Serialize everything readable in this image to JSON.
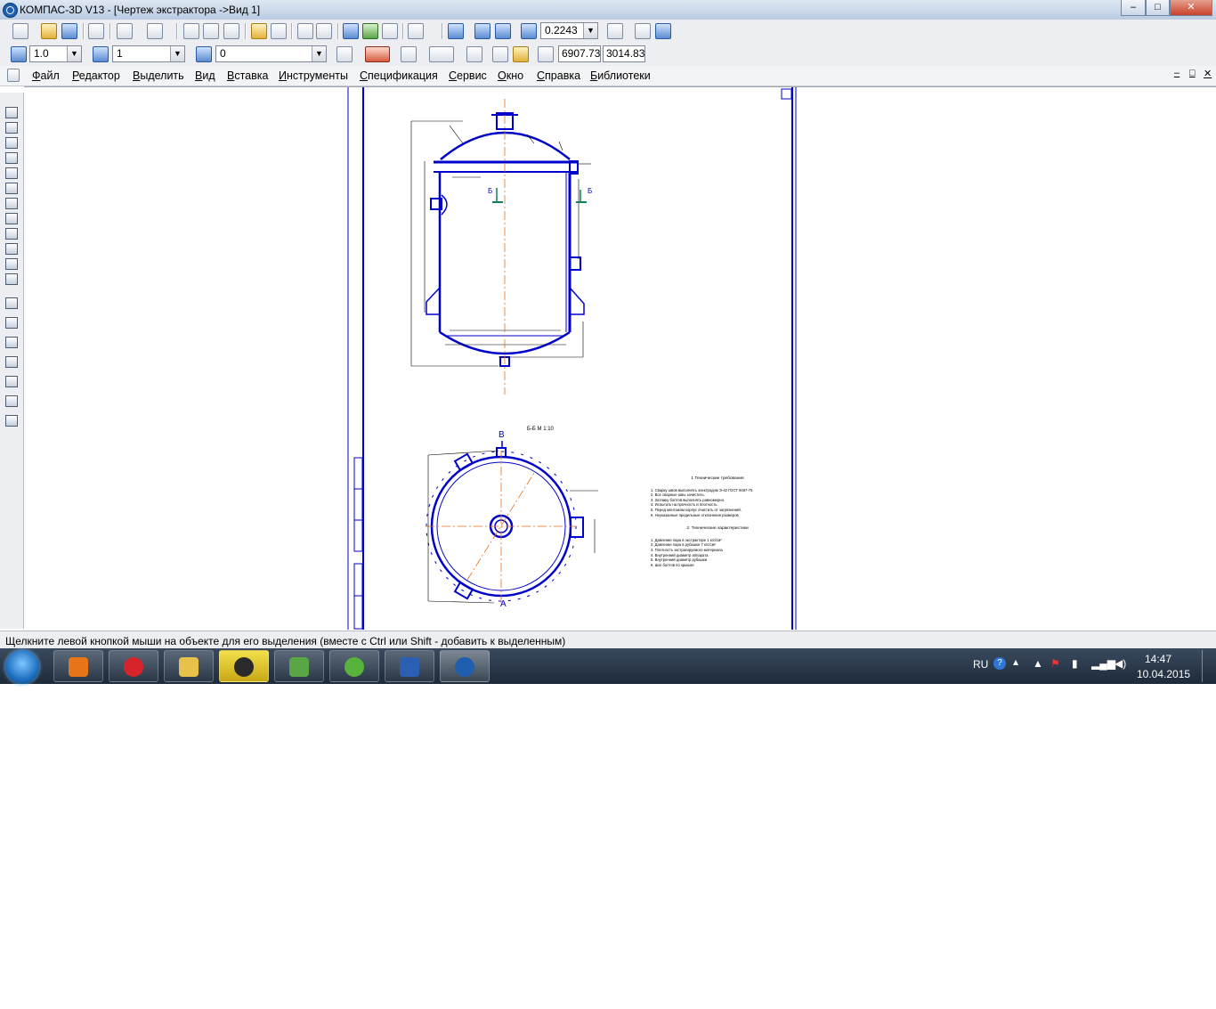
{
  "window": {
    "title": "КОМПАС-3D V13 - [Чертеж экстрактора ->Вид 1]",
    "buttons": {
      "minimize": "–",
      "maximize": "□",
      "close": "✕"
    }
  },
  "toolbar1": {
    "zoom_value": "0.2243"
  },
  "toolbar2": {
    "scale_value": "1.0",
    "layer_value": "1",
    "style_value": "0",
    "coord_x": "6907.73",
    "coord_y": "3014.83"
  },
  "menu": {
    "items": [
      "Файл",
      "Редактор",
      "Выделить",
      "Вид",
      "Вставка",
      "Инструменты",
      "Спецификация",
      "Сервис",
      "Окно",
      "Справка",
      "Библиотеки"
    ]
  },
  "drawing": {
    "section_label": "Б-Б М 1:10",
    "label_b_left": "Б",
    "label_b_right": "Б",
    "label_v": "В",
    "label_a": "А",
    "notes_title": "1 Технические требования",
    "notes_lines": [
      "1. Сварку швов выполнять электродом Э-42 ГОСТ 9467-75",
      "2. Все сварные швы зачистить.",
      "3. Затяжку болтов выполнять равномерно.",
      "4. Испытать на прочность и плотность.",
      "5. Перед монтажом корпус очистить от загрязнений.",
      "6. Неуказанные предельные отклонения размеров"
    ],
    "specs_title": "2. Технические характеристики",
    "specs_lines": [
      "1. Давление пара в экстракторе 1 кгс/см²",
      "2. Давление пара в рубашке 7 кгс/см²",
      "3. Плотность экстрагируемого материала",
      "4. Внутренний диаметр аппарата",
      "5. Внутренний диаметр рубашки",
      "6. Шаг болтов по крышке"
    ]
  },
  "status": {
    "text": "Щелкните левой кнопкой мыши на объекте для его выделения (вместе с Ctrl или Shift - добавить к выделенным)"
  },
  "taskbar": {
    "lang": "RU",
    "time": "14:47",
    "date": "10.04.2015"
  },
  "colors": {
    "drawing_blue": "#0000cc",
    "axis_orange": "#e07020",
    "leader_green": "#108060"
  }
}
